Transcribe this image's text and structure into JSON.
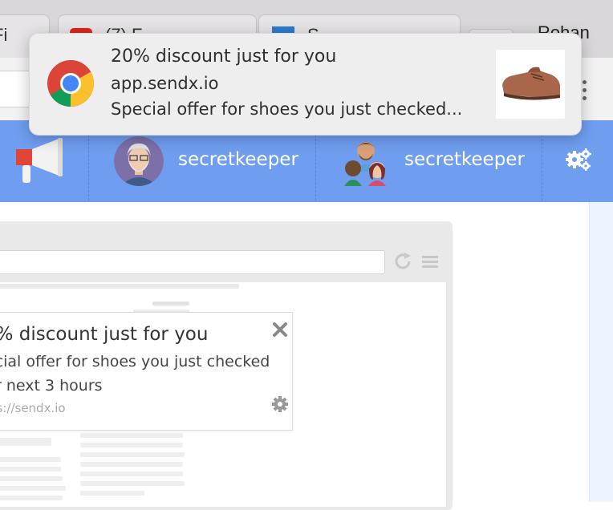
{
  "browser": {
    "tabs": [
      {
        "label": "Fi"
      },
      {
        "label": "(7) F"
      },
      {
        "label": "S"
      }
    ],
    "profile_name": "Rohan"
  },
  "system_notification": {
    "title": "20% discount just for you",
    "site": "app.sendx.io",
    "message": "Special offer for shoes you just checked..."
  },
  "app_header": {
    "accounts": [
      {
        "name": "secretkeeper"
      },
      {
        "name": "secretkeeper"
      }
    ]
  },
  "mock_notification": {
    "title": "0% discount just for you",
    "body_line1": "ecial offer for shoes you just checked",
    "body_line2": "r next 3 hours",
    "url": "ps://sendx.io"
  },
  "colors": {
    "header_blue": "#6f9ef0",
    "megaphone_red": "#e0453a"
  }
}
